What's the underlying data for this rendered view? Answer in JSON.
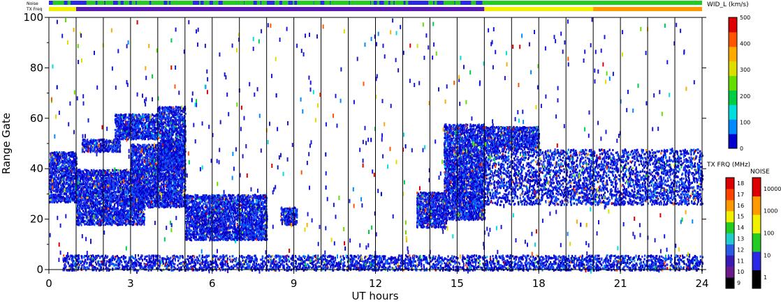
{
  "chart_data": {
    "type": "heatmap",
    "xlabel": "UT hours",
    "ylabel": "Range Gate",
    "xlim": [
      0,
      24
    ],
    "ylim": [
      0,
      100
    ],
    "x_ticks": [
      "0",
      "3",
      "6",
      "9",
      "12",
      "15",
      "18",
      "21",
      "24"
    ],
    "y_ticks": [
      "0",
      "20",
      "40",
      "60",
      "80",
      "100"
    ],
    "hour_gridlines": true,
    "header_strips": [
      {
        "label": "Noise",
        "segments": [
          {
            "from": 0,
            "to": 16,
            "level": "mixed 10-100",
            "color": "#2a2ae6"
          },
          {
            "from": 16,
            "to": 24,
            "level": "100",
            "color": "#22cc22"
          }
        ]
      },
      {
        "label": "TX Freq",
        "segments": [
          {
            "from": 0,
            "to": 1,
            "mhz": 14,
            "color": "#f0f000"
          },
          {
            "from": 1,
            "to": 16,
            "mhz": 11,
            "color": "#5a1ab4"
          },
          {
            "from": 16,
            "to": 20,
            "mhz": 14,
            "color": "#f0f000"
          },
          {
            "from": 20,
            "to": 24,
            "mhz": 15,
            "color": "#ff9900"
          }
        ]
      }
    ],
    "colorbars": [
      {
        "title": "WID_L (km/s)",
        "min": 0,
        "max": 500,
        "ticks": [
          "0",
          "100",
          "200",
          "300",
          "400",
          "500"
        ],
        "colors": [
          "#0000cc",
          "#0088ff",
          "#00dddd",
          "#00cc44",
          "#66dd00",
          "#dddd00",
          "#ffaa00",
          "#ff5500",
          "#dd0000"
        ]
      },
      {
        "title": "TX FRQ (MHz)",
        "ticks": [
          "9",
          "10",
          "11",
          "12",
          "13",
          "14",
          "15",
          "16",
          "17",
          "18"
        ],
        "colors": [
          "#000000",
          "#6a1a8a",
          "#3a1ab4",
          "#2a5ae6",
          "#22cccc",
          "#22cc22",
          "#f0f000",
          "#ff9900",
          "#ff4400",
          "#dd0000"
        ]
      },
      {
        "title": "NOISE",
        "ticks": [
          "1",
          "10",
          "100",
          "1000",
          "10000"
        ],
        "colors": [
          "#000000",
          "#2a2ae6",
          "#22cc22",
          "#f0f000",
          "#ff9900",
          "#dd0000"
        ]
      }
    ],
    "scatter_regions": [
      {
        "x": [
          0.0,
          1.0
        ],
        "y": [
          27,
          47
        ],
        "value": 50
      },
      {
        "x": [
          1.0,
          3.5
        ],
        "y": [
          18,
          40
        ],
        "value": 50
      },
      {
        "x": [
          1.2,
          2.6
        ],
        "y": [
          47,
          52
        ],
        "value": 50
      },
      {
        "x": [
          2.4,
          4.0
        ],
        "y": [
          52,
          62
        ],
        "value": 50
      },
      {
        "x": [
          3.0,
          5.0
        ],
        "y": [
          25,
          50
        ],
        "value": 50
      },
      {
        "x": [
          4.0,
          5.0
        ],
        "y": [
          40,
          65
        ],
        "value": 50
      },
      {
        "x": [
          5.0,
          8.0
        ],
        "y": [
          12,
          30
        ],
        "value": 50
      },
      {
        "x": [
          8.5,
          9.1
        ],
        "y": [
          18,
          25
        ],
        "value": 50
      },
      {
        "x": [
          13.5,
          14.6
        ],
        "y": [
          17,
          31
        ],
        "value": 50
      },
      {
        "x": [
          14.5,
          16.0
        ],
        "y": [
          20,
          58
        ],
        "value": 50
      },
      {
        "x": [
          16.0,
          24.0
        ],
        "y": [
          26,
          48
        ],
        "value": 50
      },
      {
        "x": [
          16.0,
          18.0
        ],
        "y": [
          48,
          57
        ],
        "value": 50
      },
      {
        "x": [
          0.5,
          24.0
        ],
        "y": [
          0,
          6
        ],
        "value": 30
      }
    ]
  }
}
